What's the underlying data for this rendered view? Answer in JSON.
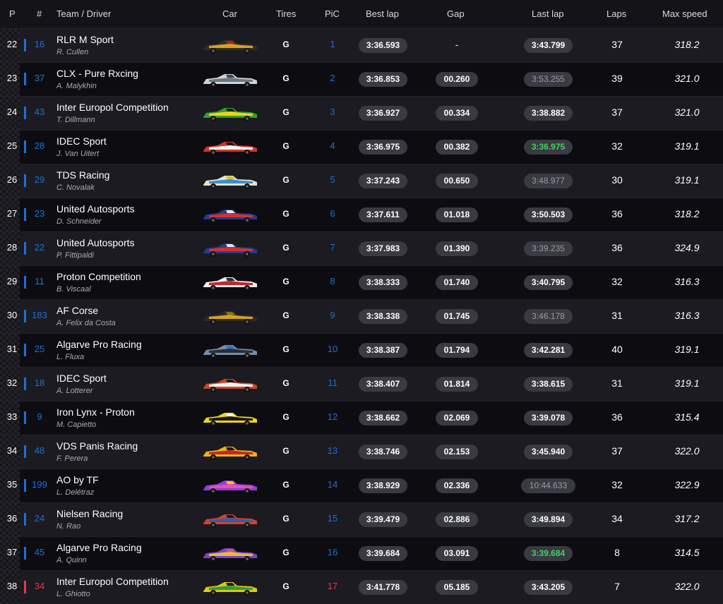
{
  "headers": {
    "p": "P",
    "num": "#",
    "team": "Team / Driver",
    "car": "Car",
    "tires": "Tires",
    "pic": "PiC",
    "best": "Best lap",
    "gap": "Gap",
    "last": "Last lap",
    "laps": "Laps",
    "speed": "Max speed"
  },
  "colors": {
    "blue_class": "#1e6fd9",
    "red_class": "#e53945",
    "green_time": "#43d35a"
  },
  "rows": [
    {
      "p": "22",
      "num": "16",
      "team": "RLR M Sport",
      "driver": "R. Cullen",
      "tire": "G",
      "pic": "1",
      "best": "3:36.593",
      "gap": "-",
      "last": "3:43.799",
      "last_style": "normal",
      "laps": "37",
      "speed": "318.2",
      "cls": "blue",
      "car_colors": [
        "#2d2d2d",
        "#d9a21b",
        "#b11e1e"
      ]
    },
    {
      "p": "23",
      "num": "37",
      "team": "CLX - Pure Rxcing",
      "driver": "A. Malykhin",
      "tire": "G",
      "pic": "2",
      "best": "3:36.853",
      "gap": "00.260",
      "last": "3:53.255",
      "last_style": "dim",
      "laps": "39",
      "speed": "321.0",
      "cls": "blue",
      "car_colors": [
        "#cfd4d8",
        "#6c7680",
        "#3c4650"
      ]
    },
    {
      "p": "24",
      "num": "43",
      "team": "Inter Europol Competition",
      "driver": "T. Dillmann",
      "tire": "G",
      "pic": "3",
      "best": "3:36.927",
      "gap": "00.334",
      "last": "3:38.882",
      "last_style": "normal",
      "laps": "37",
      "speed": "321.0",
      "cls": "blue",
      "car_colors": [
        "#2ea12e",
        "#f1d21a",
        "#1a1a1a"
      ]
    },
    {
      "p": "25",
      "num": "28",
      "team": "IDEC Sport",
      "driver": "J. Van Uitert",
      "tire": "G",
      "pic": "4",
      "best": "3:36.975",
      "gap": "00.382",
      "last": "3:36.975",
      "last_style": "green",
      "laps": "32",
      "speed": "319.1",
      "cls": "blue",
      "car_colors": [
        "#d2332b",
        "#f2f2f2",
        "#1a1a1a"
      ]
    },
    {
      "p": "26",
      "num": "29",
      "team": "TDS Racing",
      "driver": "C. Novalak",
      "tire": "G",
      "pic": "5",
      "best": "3:37.243",
      "gap": "00.650",
      "last": "3:48.977",
      "last_style": "dim",
      "laps": "30",
      "speed": "319.1",
      "cls": "blue",
      "car_colors": [
        "#e8e3c9",
        "#3b8ed2",
        "#d8c12b"
      ]
    },
    {
      "p": "27",
      "num": "23",
      "team": "United Autosports",
      "driver": "D. Schneider",
      "tire": "G",
      "pic": "6",
      "best": "3:37.611",
      "gap": "01.018",
      "last": "3:50.503",
      "last_style": "normal",
      "laps": "36",
      "speed": "318.2",
      "cls": "blue",
      "car_colors": [
        "#1f3e8f",
        "#d7302c",
        "#e8e8e8"
      ]
    },
    {
      "p": "28",
      "num": "22",
      "team": "United Autosports",
      "driver": "P. Fittipaldi",
      "tire": "G",
      "pic": "7",
      "best": "3:37.983",
      "gap": "01.390",
      "last": "3:39.235",
      "last_style": "dim",
      "laps": "36",
      "speed": "324.9",
      "cls": "blue",
      "car_colors": [
        "#1f3e8f",
        "#d7302c",
        "#e8e8e8"
      ]
    },
    {
      "p": "29",
      "num": "11",
      "team": "Proton Competition",
      "driver": "B. Viscaal",
      "tire": "G",
      "pic": "8",
      "best": "3:38.333",
      "gap": "01.740",
      "last": "3:40.795",
      "last_style": "normal",
      "laps": "32",
      "speed": "316.3",
      "cls": "blue",
      "car_colors": [
        "#f0f0f0",
        "#c4252b",
        "#2b2b2b"
      ]
    },
    {
      "p": "30",
      "num": "183",
      "team": "AF Corse",
      "driver": "A. Felix da Costa",
      "tire": "G",
      "pic": "9",
      "best": "3:38.338",
      "gap": "01.745",
      "last": "3:46.178",
      "last_style": "dim",
      "laps": "31",
      "speed": "316.3",
      "cls": "blue",
      "car_colors": [
        "#2b2b2b",
        "#d4a21e",
        "#8a6f1a"
      ]
    },
    {
      "p": "31",
      "num": "25",
      "team": "Algarve Pro Racing",
      "driver": "L. Fluxa",
      "tire": "G",
      "pic": "10",
      "best": "3:38.387",
      "gap": "01.794",
      "last": "3:42.281",
      "last_style": "normal",
      "laps": "40",
      "speed": "319.1",
      "cls": "blue",
      "car_colors": [
        "#6e8fb0",
        "#2d2d2d",
        "#3d6fd0"
      ]
    },
    {
      "p": "32",
      "num": "18",
      "team": "IDEC Sport",
      "driver": "A. Lotterer",
      "tire": "G",
      "pic": "11",
      "best": "3:38.407",
      "gap": "01.814",
      "last": "3:38.615",
      "last_style": "normal",
      "laps": "31",
      "speed": "319.1",
      "cls": "blue",
      "car_colors": [
        "#c7472a",
        "#f2f2f2",
        "#1a1a1a"
      ]
    },
    {
      "p": "33",
      "num": "9",
      "team": "Iron Lynx - Proton",
      "driver": "M. Capietto",
      "tire": "G",
      "pic": "12",
      "best": "3:38.662",
      "gap": "02.069",
      "last": "3:39.078",
      "last_style": "normal",
      "laps": "36",
      "speed": "315.4",
      "cls": "blue",
      "car_colors": [
        "#f2d41c",
        "#1a1a1a",
        "#f2f2f2"
      ]
    },
    {
      "p": "34",
      "num": "48",
      "team": "VDS Panis Racing",
      "driver": "F. Perera",
      "tire": "G",
      "pic": "13",
      "best": "3:38.746",
      "gap": "02.153",
      "last": "3:45.940",
      "last_style": "normal",
      "laps": "37",
      "speed": "322.0",
      "cls": "blue",
      "car_colors": [
        "#e9b41c",
        "#c9261f",
        "#1a1a1a"
      ]
    },
    {
      "p": "35",
      "num": "199",
      "team": "AO by TF",
      "driver": "L. Delétraz",
      "tire": "G",
      "pic": "14",
      "best": "3:38.929",
      "gap": "02.336",
      "last": "10:44.633",
      "last_style": "dim",
      "laps": "32",
      "speed": "322.9",
      "cls": "blue",
      "car_colors": [
        "#8b3fd8",
        "#e84fb1",
        "#f2c51c"
      ]
    },
    {
      "p": "36",
      "num": "24",
      "team": "Nielsen Racing",
      "driver": "N. Rao",
      "tire": "G",
      "pic": "15",
      "best": "3:39.479",
      "gap": "02.886",
      "last": "3:49.894",
      "last_style": "normal",
      "laps": "34",
      "speed": "317.2",
      "cls": "blue",
      "car_colors": [
        "#d9402a",
        "#2e5fb0",
        "#1a1a1a"
      ]
    },
    {
      "p": "37",
      "num": "45",
      "team": "Algarve Pro Racing",
      "driver": "A. Quinn",
      "tire": "G",
      "pic": "16",
      "best": "3:39.684",
      "gap": "03.091",
      "last": "3:39.684",
      "last_style": "green",
      "laps": "8",
      "speed": "314.5",
      "cls": "blue",
      "car_colors": [
        "#7d3fd0",
        "#e0c02a",
        "#d94b8a"
      ]
    },
    {
      "p": "38",
      "num": "34",
      "team": "Inter Europol Competition",
      "driver": "L. Ghiotto",
      "tire": "G",
      "pic": "17",
      "best": "3:41.778",
      "gap": "05.185",
      "last": "3:43.205",
      "last_style": "normal",
      "laps": "7",
      "speed": "322.0",
      "cls": "red",
      "car_colors": [
        "#e3c51c",
        "#2ea12e",
        "#1a1a1a"
      ]
    }
  ]
}
